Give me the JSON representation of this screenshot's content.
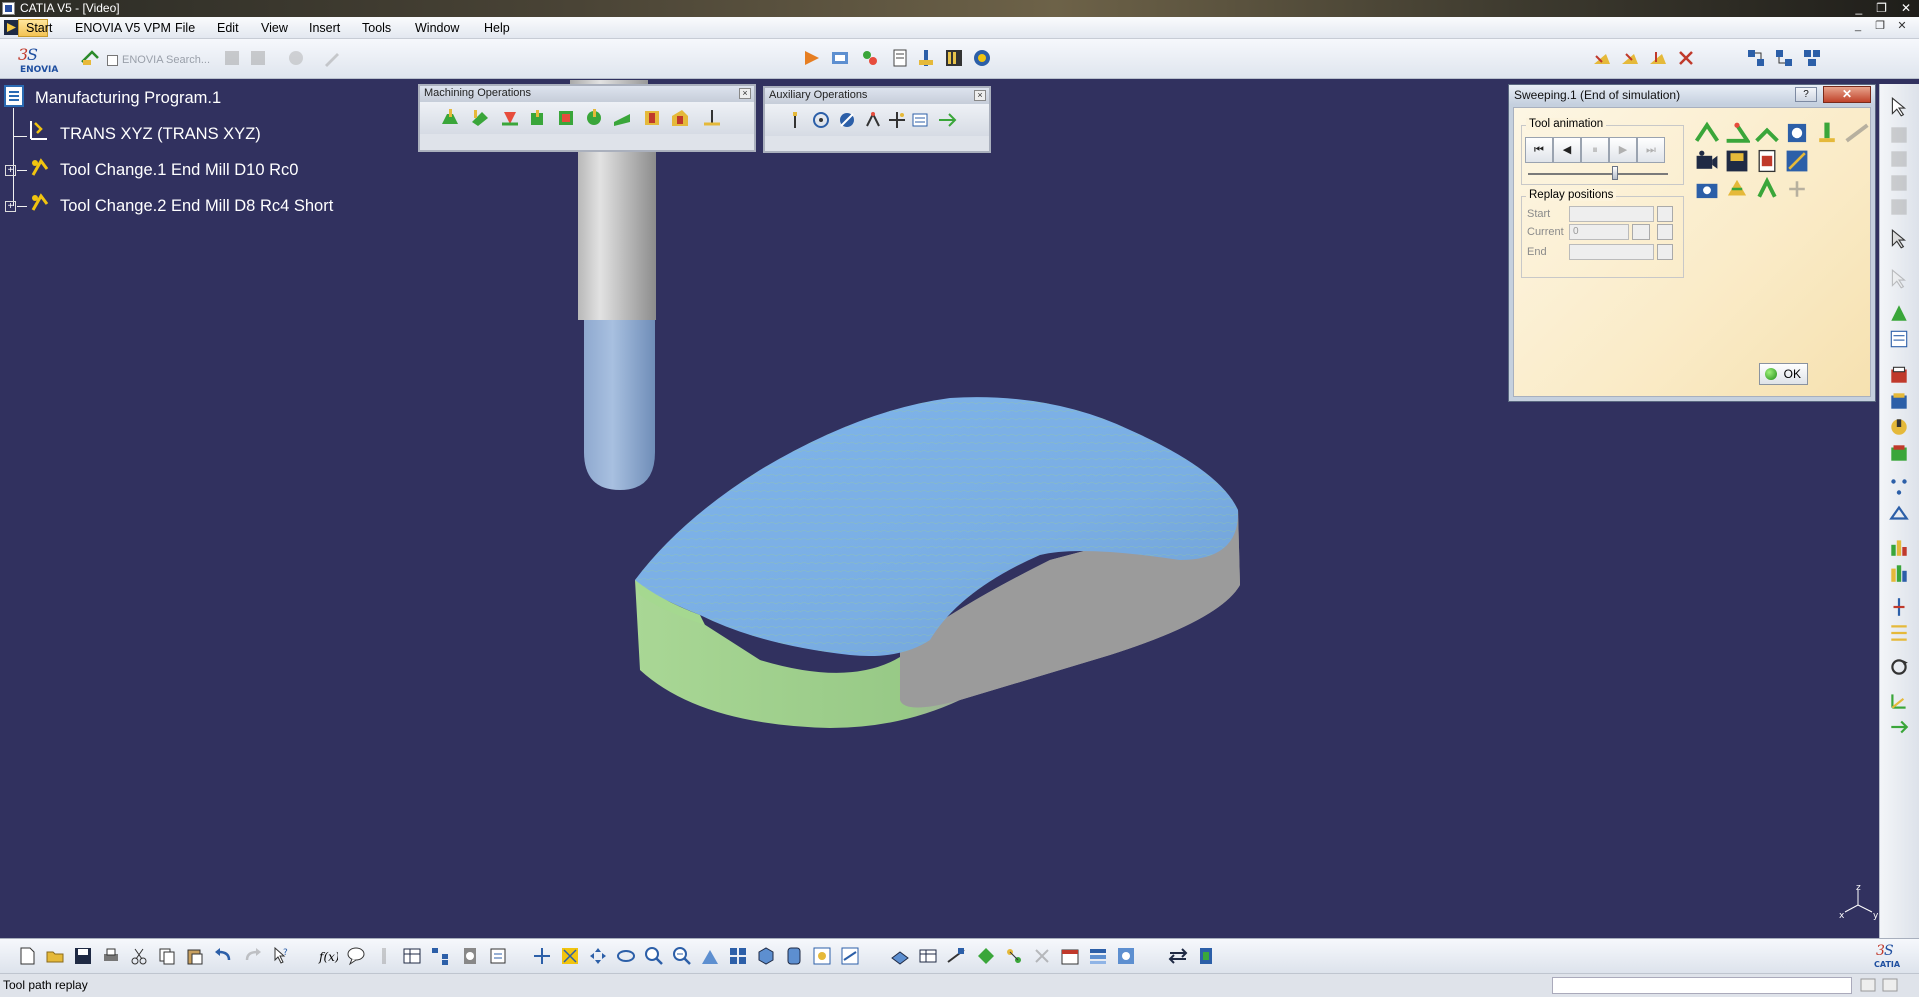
{
  "window": {
    "title": "CATIA V5 - [Video]",
    "controls": [
      "_",
      "❐",
      "✕"
    ]
  },
  "menubar": {
    "items": [
      "Start",
      "ENOVIA V5 VPM",
      "File",
      "Edit",
      "View",
      "Insert",
      "Tools",
      "Window",
      "Help"
    ],
    "doc_controls": [
      "_",
      "❐",
      "✕"
    ]
  },
  "toolbar": {
    "enovia_search_placeholder": "ENOVIA Search..."
  },
  "tree": {
    "root": "Manufacturing Program.1",
    "nodes": [
      "TRANS XYZ (TRANS XYZ)",
      "Tool Change.1  End Mill D10 Rc0",
      "Tool Change.2  End Mill D8 Rc4 Short"
    ]
  },
  "machining_toolbar": {
    "title": "Machining Operations",
    "close": "×"
  },
  "auxiliary_toolbar": {
    "title": "Auxiliary Operations",
    "close": "×"
  },
  "sweeping_dialog": {
    "title": "Sweeping.1 (End of simulation)",
    "help": "?",
    "close": "✕",
    "tool_animation_label": "Tool animation",
    "replay_label": "Replay positions",
    "fields": {
      "start_label": "Start",
      "current_label": "Current",
      "end_label": "End",
      "current_value": "0"
    },
    "ok_label": "OK",
    "player_buttons": [
      "⏮",
      "◀",
      "⏸",
      "▶",
      "⏭"
    ],
    "slider_position": 0.62
  },
  "statusbar": {
    "text": "Tool path replay"
  },
  "compass": {
    "z": "z",
    "y": "y",
    "x": "x"
  },
  "colors": {
    "viewport_bg": "#31315f",
    "part_top": "#79aee6",
    "part_side_green": "#9ed28a",
    "part_side_gray": "#9a9a9a",
    "tool_holder": "#c8c8c8",
    "tool_blue": "#7aa3d6"
  }
}
